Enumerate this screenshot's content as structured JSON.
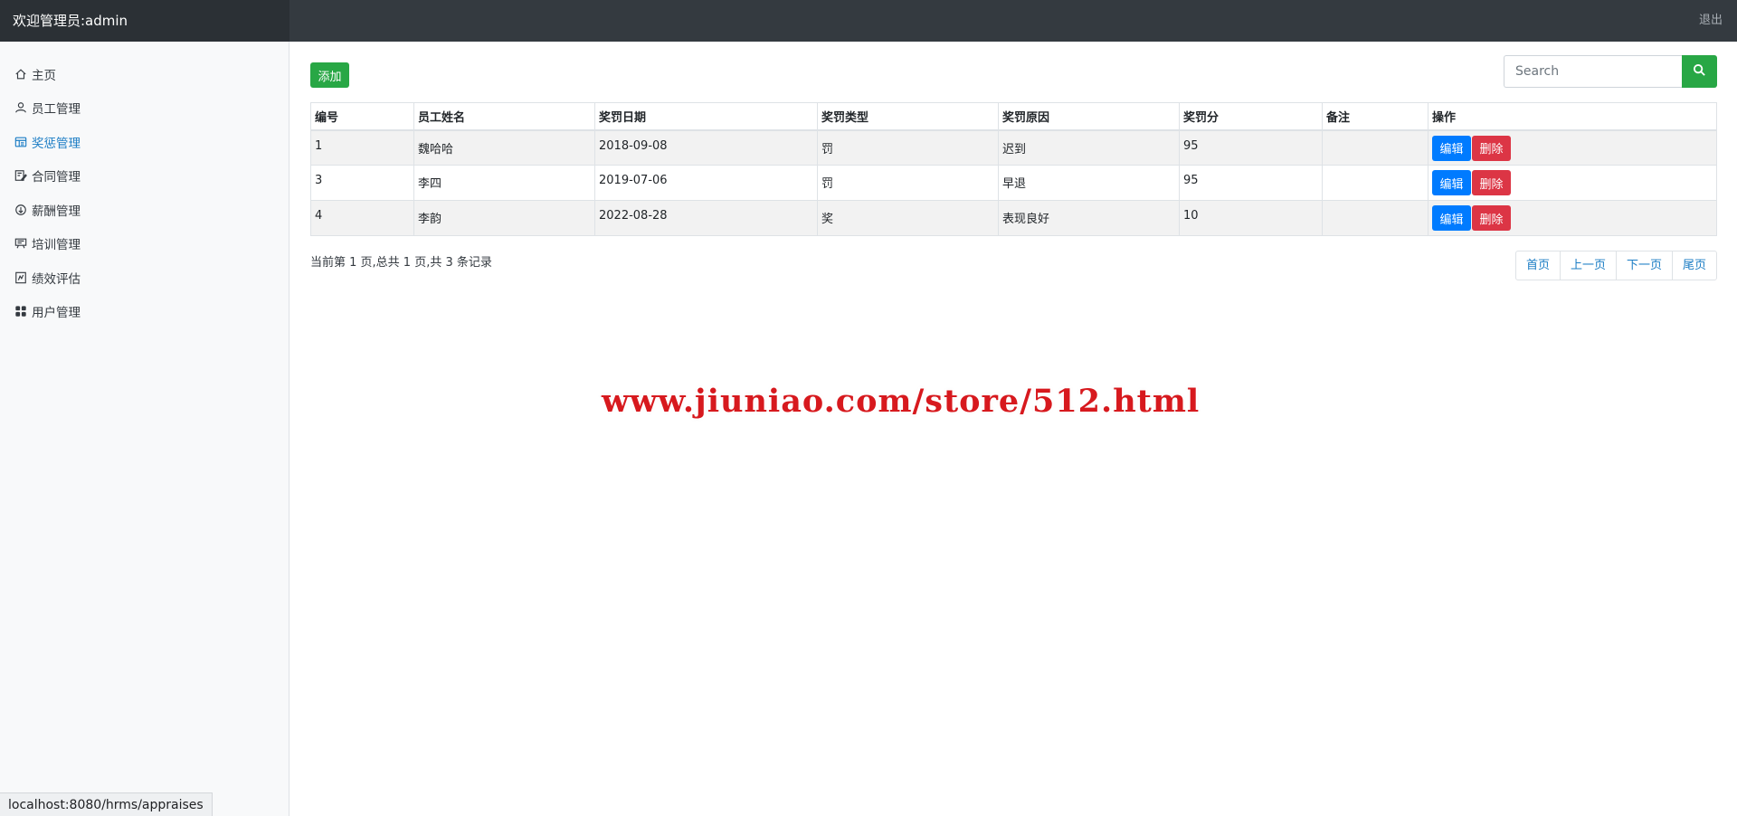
{
  "header": {
    "welcome": "欢迎管理员:admin",
    "logout": "退出"
  },
  "sidebar": {
    "items": [
      {
        "label": "主页",
        "icon": "home-icon"
      },
      {
        "label": "员工管理",
        "icon": "user-icon"
      },
      {
        "label": "奖惩管理",
        "icon": "table-icon",
        "active": true
      },
      {
        "label": "合同管理",
        "icon": "edit-document-icon"
      },
      {
        "label": "薪酬管理",
        "icon": "coin-icon"
      },
      {
        "label": "培训管理",
        "icon": "presentation-icon"
      },
      {
        "label": "绩效评估",
        "icon": "chart-icon"
      },
      {
        "label": "用户管理",
        "icon": "grid-icon"
      }
    ]
  },
  "toolbar": {
    "add_label": "添加",
    "search_placeholder": "Search"
  },
  "table": {
    "headers": [
      "编号",
      "员工姓名",
      "奖罚日期",
      "奖罚类型",
      "奖罚原因",
      "奖罚分",
      "备注",
      "操作"
    ],
    "rows": [
      {
        "id": "1",
        "name": "魏哈哈",
        "date": "2018-09-08",
        "type": "罚",
        "reason": "迟到",
        "score": "95",
        "note": ""
      },
      {
        "id": "3",
        "name": "李四",
        "date": "2019-07-06",
        "type": "罚",
        "reason": "早退",
        "score": "95",
        "note": ""
      },
      {
        "id": "4",
        "name": "李韵",
        "date": "2022-08-28",
        "type": "奖",
        "reason": "表现良好",
        "score": "10",
        "note": ""
      }
    ],
    "edit_label": "编辑",
    "delete_label": "删除"
  },
  "pagination": {
    "info": "当前第 1 页,总共 1 页,共 3 条记录",
    "first": "首页",
    "prev": "上一页",
    "next": "下一页",
    "last": "尾页"
  },
  "watermark": "www.jiuniao.com/store/512.html",
  "status_bar": {
    "url": "localhost:8080/hrms/appraises"
  },
  "colors": {
    "topbar": "#343a40",
    "success": "#28a745",
    "primary": "#007bff",
    "danger": "#dc3545",
    "active_link": "#1a7cc4"
  }
}
